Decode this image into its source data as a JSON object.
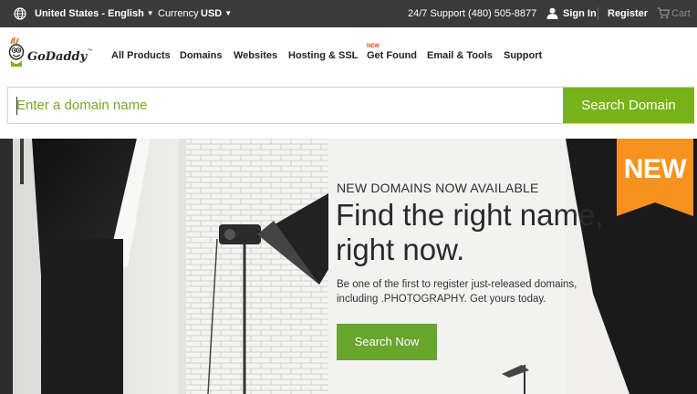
{
  "topbar": {
    "locale": "United States - English",
    "currency_label": "Currency",
    "currency_value": "USD",
    "support": "24/7 Support (480) 505-8877",
    "sign_in": "Sign In",
    "register": "Register",
    "cart": "Cart"
  },
  "brand": {
    "logo_text": "GoDaddy"
  },
  "nav": {
    "items": [
      "All Products",
      "Domains",
      "Websites",
      "Hosting & SSL",
      "Get Found",
      "Email & Tools",
      "Support"
    ],
    "new_badge": "NEW"
  },
  "search": {
    "placeholder": "Enter a domain name",
    "button": "Search Domain"
  },
  "hero": {
    "kicker": "NEW DOMAINS NOW AVAILABLE",
    "title": "Find the right name, right now.",
    "body": "Be one of the first to register just-released domains, including .PHOTOGRAPHY. Get yours today.",
    "cta": "Search Now",
    "tag": "NEW"
  },
  "colors": {
    "topbar_bg": "#3a3a3a",
    "accent_green": "#78b219",
    "new_orange": "#f7921e",
    "new_badge_red": "#e34a16"
  },
  "icons": [
    "globe-icon",
    "user-icon",
    "cart-icon",
    "godaddy-guy-logo"
  ]
}
